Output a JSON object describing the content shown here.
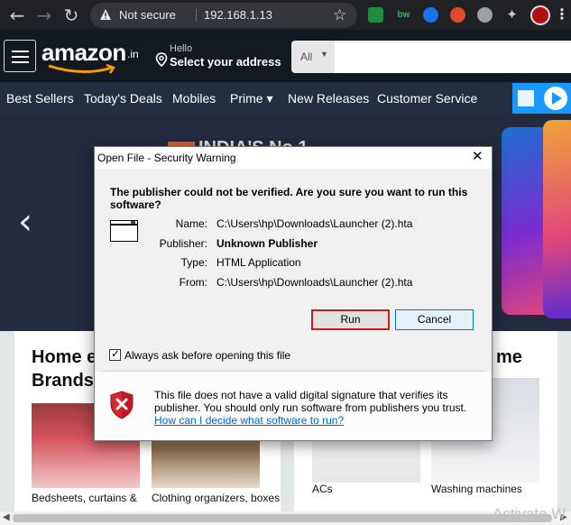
{
  "browser": {
    "security_label": "Not secure",
    "url": "192.168.1.13",
    "icons": [
      "back-icon",
      "forward-icon",
      "warning-icon",
      "star-icon",
      "extension-icons",
      "profile-avatar",
      "menu-icon"
    ]
  },
  "amazon": {
    "logo": "amazon",
    "logo_suffix": ".in",
    "greeting": "Hello",
    "address_prompt": "Select your address",
    "search_category": "All",
    "nav_items": [
      "Best Sellers",
      "Today's Deals",
      "Mobiles",
      "Prime ▾",
      "New Releases",
      "Customer Service"
    ],
    "hero_title": "INDIA'S No.1",
    "cards": [
      {
        "title": "Home e",
        "title2": "Brands",
        "labels": [
          "Bedsheets, curtains &",
          "Clothing organizers, boxes"
        ]
      },
      {
        "title": "me",
        "labels": [
          "ACs",
          "Washing machines"
        ]
      }
    ]
  },
  "dialog": {
    "title": "Open File - Security Warning",
    "question": "The publisher could not be verified.  Are you sure you want to run this software?",
    "fields": [
      {
        "key": "Name:",
        "value": "C:\\Users\\hp\\Downloads\\Launcher (2).hta",
        "bold": false
      },
      {
        "key": "Publisher:",
        "value": "Unknown Publisher",
        "bold": true
      },
      {
        "key": "Type:",
        "value": "HTML Application",
        "bold": false
      },
      {
        "key": "From:",
        "value": "C:\\Users\\hp\\Downloads\\Launcher (2).hta",
        "bold": false
      }
    ],
    "run_label": "Run",
    "cancel_label": "Cancel",
    "checkbox_label": "Always ask before opening this file",
    "checkbox_checked": true,
    "warning_text": "This file does not have a valid digital signature that verifies its publisher.  You should only run software from publishers you trust.",
    "help_link": "How can I decide what software to run?"
  },
  "os": {
    "watermark": "Activate W"
  },
  "colors": {
    "chrome_bg": "#202124",
    "amazon_header": "#131921",
    "amazon_nav": "#232f3e",
    "run_focus": "#c41e23",
    "cancel_accent": "#0078d7",
    "link": "#0066cc"
  }
}
